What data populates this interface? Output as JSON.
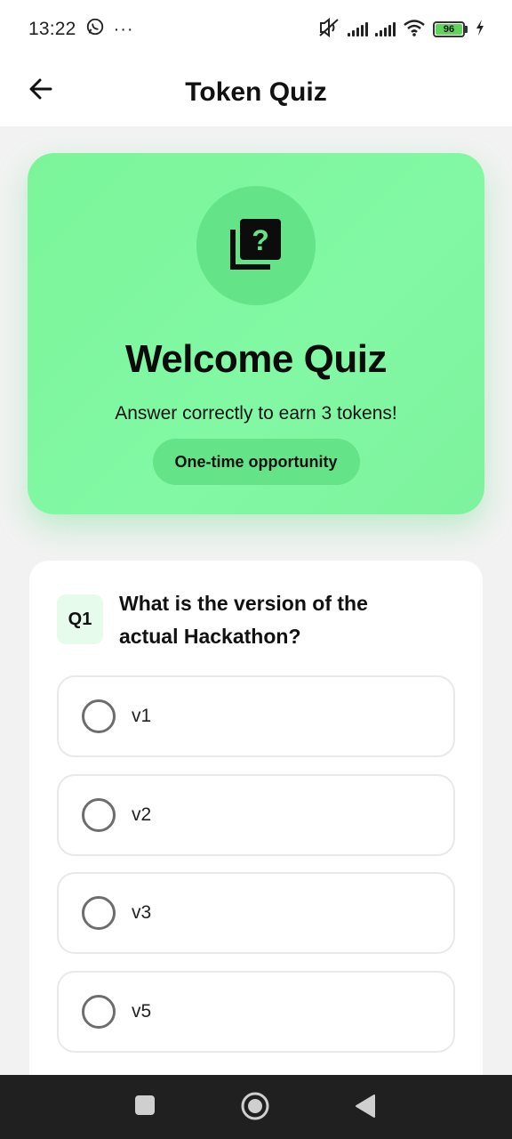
{
  "status_bar": {
    "time": "13:22",
    "battery_level": "96",
    "icons": [
      "whatsapp-icon",
      "more-icon",
      "mute-icon",
      "signal-icon",
      "signal-icon",
      "wifi-icon",
      "battery-icon",
      "charging-icon"
    ]
  },
  "app_bar": {
    "title": "Token Quiz",
    "back_icon": "arrow-left-icon"
  },
  "hero": {
    "icon": "quiz-icon",
    "title": "Welcome Quiz",
    "subtitle": "Answer correctly to earn 3 tokens!",
    "badge": "One-time opportunity",
    "colors": {
      "background": "#7ff7a0",
      "accent": "#64e389"
    }
  },
  "question": {
    "number": "Q1",
    "text": "What is the version of the actual Hackathon?",
    "options": [
      {
        "label": "v1"
      },
      {
        "label": "v2"
      },
      {
        "label": "v3"
      },
      {
        "label": "v5"
      }
    ]
  },
  "nav_bar": {
    "items": [
      "recents-icon",
      "home-icon",
      "back-icon"
    ]
  }
}
